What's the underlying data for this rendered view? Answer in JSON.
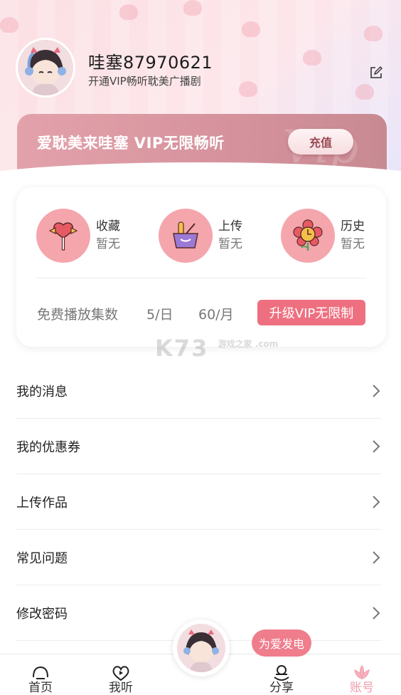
{
  "profile": {
    "username": "哇塞87970621",
    "subtitle": "开通VIP畅听耽美广播剧"
  },
  "vip_banner": {
    "text": "爱耽美来哇塞 VIP无限畅听",
    "recharge_label": "充值"
  },
  "stats": [
    {
      "label": "收藏",
      "value": "暂无",
      "icon": "lollipop-icon"
    },
    {
      "label": "上传",
      "value": "暂无",
      "icon": "basket-icon"
    },
    {
      "label": "历史",
      "value": "暂无",
      "icon": "flower-clock-icon"
    }
  ],
  "free_play": {
    "label": "免费播放集数",
    "per_day": "5/日",
    "per_month": "60/月",
    "upgrade_label": "升级VIP无限制"
  },
  "watermark": {
    "text": "K73",
    "sub": "游戏之家 .com"
  },
  "menu": [
    {
      "label": "我的消息"
    },
    {
      "label": "我的优惠券"
    },
    {
      "label": "上传作品"
    },
    {
      "label": "常见问题"
    },
    {
      "label": "修改密码"
    }
  ],
  "tabs": [
    {
      "label": "首页",
      "icon": "home-icon"
    },
    {
      "label": "我听",
      "icon": "heart-play-icon"
    },
    {
      "label": "分享",
      "icon": "share-icon"
    },
    {
      "label": "账号",
      "icon": "lotus-icon",
      "active": true
    }
  ],
  "bubble": "为爱发电",
  "colors": {
    "accent": "#ee7080",
    "stat_circle": "#f4a6ac",
    "active_tab": "#f19cab"
  }
}
